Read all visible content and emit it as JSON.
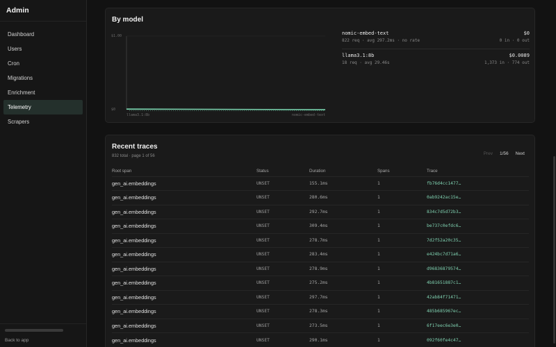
{
  "sidebar": {
    "title": "Admin",
    "items": [
      {
        "label": "Dashboard",
        "active": false
      },
      {
        "label": "Users",
        "active": false
      },
      {
        "label": "Cron",
        "active": false
      },
      {
        "label": "Migrations",
        "active": false
      },
      {
        "label": "Enrichment",
        "active": false
      },
      {
        "label": "Telemetry",
        "active": true
      },
      {
        "label": "Scrapers",
        "active": false
      }
    ],
    "back_label": "Back to app"
  },
  "by_model": {
    "title": "By model",
    "models": [
      {
        "name": "nomic-embed-text",
        "cost": "$0",
        "meta": "822 req · avg 297.2ms · no rate",
        "tokens": "0 in · 0 out"
      },
      {
        "name": "llama3.1:8b",
        "cost": "$0.0089",
        "meta": "18 req · avg 29.46s",
        "tokens": "1,373 in · 774 out"
      }
    ]
  },
  "chart_data": {
    "type": "area",
    "categories": [
      "llama3.1:8b",
      "nomic-embed-text"
    ],
    "ylim": [
      0,
      1.0
    ],
    "y_ticks": [
      "$1.00",
      "$0"
    ],
    "x_labels": [
      "llama3.1:8b",
      "nomic-embed-text"
    ],
    "series": [
      {
        "values": [
          0.0089,
          0
        ]
      }
    ],
    "colors": {
      "fill": "#6fd3a8",
      "line": "#7fe0b8"
    },
    "grid": false
  },
  "traces": {
    "title": "Recent traces",
    "subtitle": "832 total · page 1 of 56",
    "pager": {
      "prev": "Prev",
      "page": "1/56",
      "next": "Next"
    },
    "columns": [
      "Root span",
      "Status",
      "Duration",
      "Spans",
      "Trace"
    ],
    "rows": [
      [
        "gen_ai.embeddings",
        "UNSET",
        "155.1ms",
        "1",
        "fb76d4cc1477…"
      ],
      [
        "gen_ai.embeddings",
        "UNSET",
        "280.6ms",
        "1",
        "0ab9242ac15e…"
      ],
      [
        "gen_ai.embeddings",
        "UNSET",
        "292.7ms",
        "1",
        "834c7d5d72b3…"
      ],
      [
        "gen_ai.embeddings",
        "UNSET",
        "309.4ms",
        "1",
        "be737c0efdc6…"
      ],
      [
        "gen_ai.embeddings",
        "UNSET",
        "278.7ms",
        "1",
        "7d2f52a20c35…"
      ],
      [
        "gen_ai.embeddings",
        "UNSET",
        "283.4ms",
        "1",
        "e424bc7d71a6…"
      ],
      [
        "gen_ai.embeddings",
        "UNSET",
        "278.9ms",
        "1",
        "d96836879574…"
      ],
      [
        "gen_ai.embeddings",
        "UNSET",
        "275.2ms",
        "1",
        "4b81651887c1…"
      ],
      [
        "gen_ai.embeddings",
        "UNSET",
        "297.7ms",
        "1",
        "42ab84f71471…"
      ],
      [
        "gen_ai.embeddings",
        "UNSET",
        "278.3ms",
        "1",
        "485b685967ec…"
      ],
      [
        "gen_ai.embeddings",
        "UNSET",
        "273.5ms",
        "1",
        "6f17eec6e3e0…"
      ],
      [
        "gen_ai.embeddings",
        "UNSET",
        "290.1ms",
        "1",
        "092f60fe4c47…"
      ]
    ]
  }
}
